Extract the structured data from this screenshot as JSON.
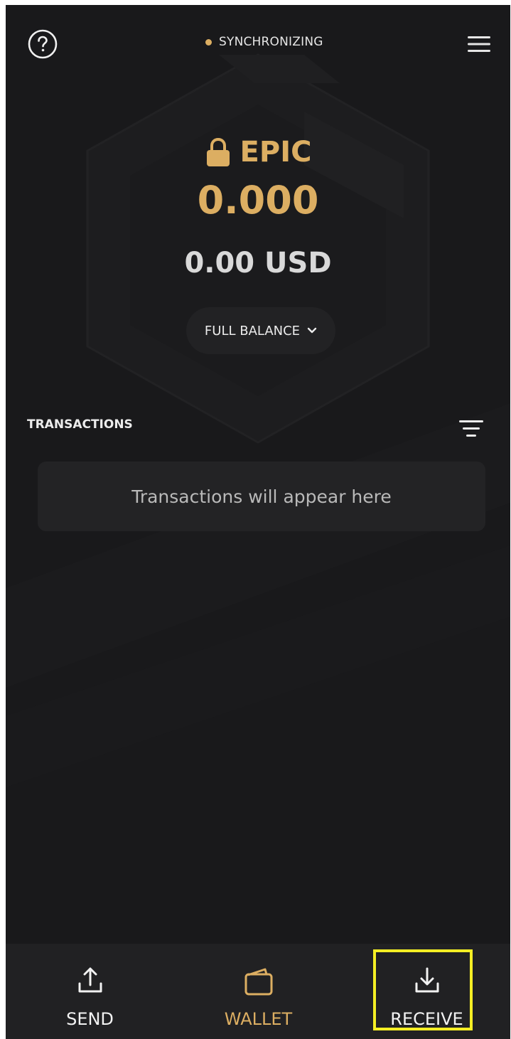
{
  "colors": {
    "background": "#19191b",
    "accent_gold": "#dcae62",
    "card": "#232325",
    "nav_bar": "#212123",
    "highlight": "#f4ee24"
  },
  "header": {
    "help_icon": "question-circle-icon",
    "status_text": "SYNCHRONIZING",
    "menu_icon": "hamburger-menu-icon"
  },
  "balance": {
    "lock_icon": "lock-icon",
    "coin": "EPIC",
    "amount": "0.000",
    "fiat": "0.00 USD",
    "selector_label": "FULL BALANCE",
    "selector_icon": "chevron-down-icon"
  },
  "transactions": {
    "title": "TRANSACTIONS",
    "filter_icon": "filter-icon",
    "empty_text": "Transactions will appear here"
  },
  "nav": {
    "send": {
      "label": "SEND",
      "icon": "upload-icon"
    },
    "wallet": {
      "label": "WALLET",
      "icon": "wallet-icon",
      "active": true
    },
    "receive": {
      "label": "RECEIVE",
      "icon": "download-icon",
      "highlighted": true
    }
  }
}
